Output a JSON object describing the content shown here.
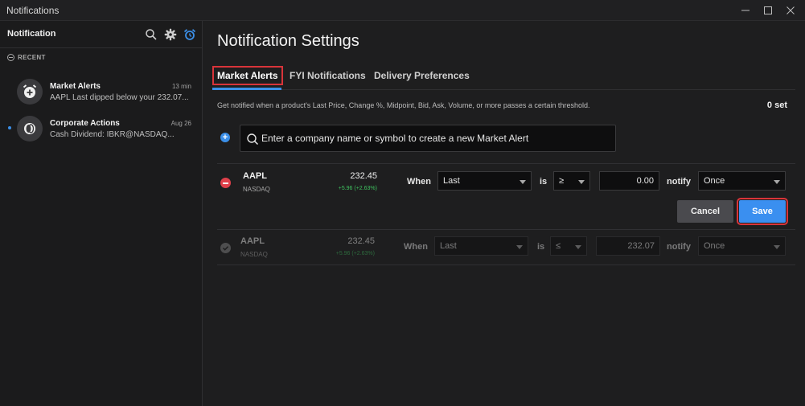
{
  "window": {
    "title": "Notifications",
    "controls": [
      "minimize-icon",
      "maximize-icon",
      "close-icon"
    ]
  },
  "sidebar": {
    "title": "Notification",
    "icons": [
      "search-icon",
      "gear-icon",
      "alarm-icon"
    ],
    "section_label": "RECENT",
    "items": [
      {
        "title": "Market Alerts",
        "time": "13 min",
        "body": "AAPL Last dipped below your 232.07...",
        "icon": "alarm-plus-icon",
        "unread": false
      },
      {
        "title": "Corporate Actions",
        "time": "Aug 26",
        "body": "Cash Dividend: IBKR@NASDAQ...",
        "icon": "corporate-actions-icon",
        "unread": true
      }
    ]
  },
  "main": {
    "title": "Notification Settings",
    "tabs": [
      {
        "label": "Market Alerts",
        "active": true
      },
      {
        "label": "FYI Notifications",
        "active": false
      },
      {
        "label": "Delivery Preferences",
        "active": false
      }
    ],
    "description": "Get notified when a product's Last Price, Change %, Midpoint, Bid, Ask, Volume, or more passes a certain threshold.",
    "set_count": "0 set",
    "search": {
      "placeholder": "Enter a company name or symbol to create a new Market Alert"
    },
    "alerts": [
      {
        "symbol": "AAPL",
        "exchange": "NASDAQ",
        "price": "232.45",
        "change": "+5.96 (+2.63%)",
        "when_label": "When",
        "field": "Last",
        "is_label": "is",
        "operator": "≥",
        "threshold": "0.00",
        "notify_label": "notify",
        "frequency": "Once",
        "enabled": true
      },
      {
        "symbol": "AAPL",
        "exchange": "NASDAQ",
        "price": "232.45",
        "change": "+5.96 (+2.63%)",
        "when_label": "When",
        "field": "Last",
        "is_label": "is",
        "operator": "≤",
        "threshold": "232.07",
        "notify_label": "notify",
        "frequency": "Once",
        "enabled": false
      }
    ],
    "buttons": {
      "cancel": "Cancel",
      "save": "Save"
    }
  },
  "colors": {
    "accent": "#3b8fe8",
    "danger": "#e0404a",
    "positive": "#3fc15f",
    "highlight": "#d9343a"
  }
}
